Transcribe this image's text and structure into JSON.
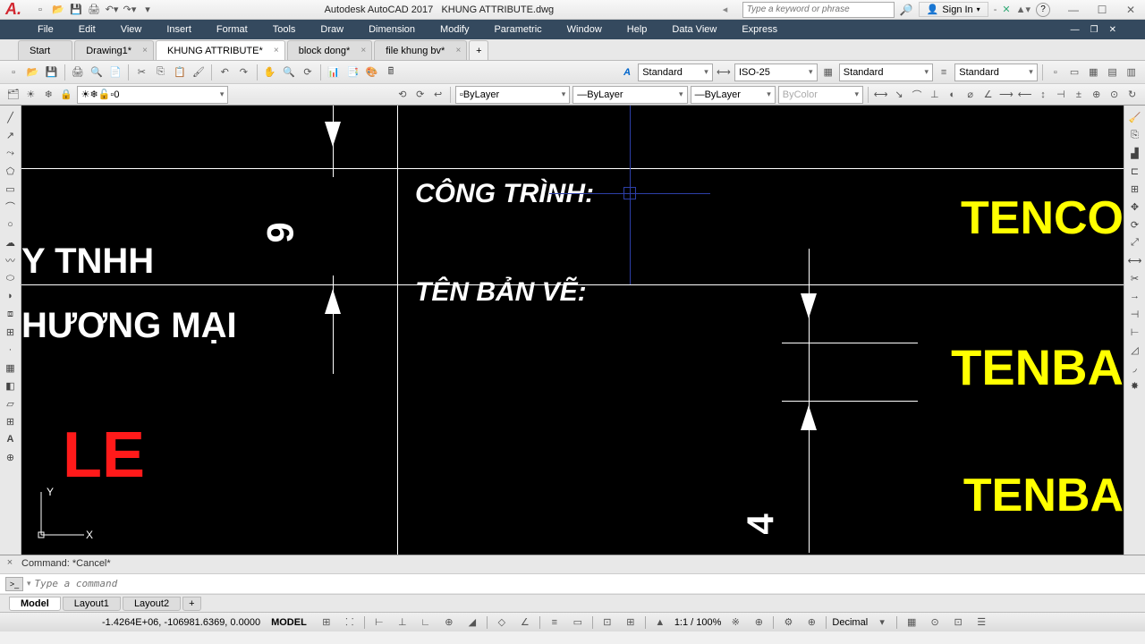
{
  "title": {
    "app": "Autodesk AutoCAD 2017",
    "doc": "KHUNG ATTRIBUTE.dwg"
  },
  "search": {
    "placeholder": "Type a keyword or phrase"
  },
  "signin": {
    "label": "Sign In"
  },
  "menu": [
    "File",
    "Edit",
    "View",
    "Insert",
    "Format",
    "Tools",
    "Draw",
    "Dimension",
    "Modify",
    "Parametric",
    "Window",
    "Help",
    "Data View",
    "Express"
  ],
  "tabs": {
    "items": [
      "Start",
      "Drawing1*",
      "KHUNG ATTRIBUTE*",
      "block dong*",
      "file khung bv*"
    ],
    "active": 2
  },
  "ribbon": {
    "style1": "Standard",
    "dim": "ISO-25",
    "style2": "Standard",
    "style3": "Standard",
    "layer": "0",
    "prop1": "ByLayer",
    "prop2": "ByLayer",
    "prop3": "ByLayer",
    "prop4": "ByColor"
  },
  "drawing": {
    "t1": "Y TNHH",
    "t2": "HƯƠNG MẠI",
    "t3": "LE",
    "t4": "CÔNG TRÌNH:",
    "t5": "TÊN BẢN VẼ:",
    "t6": "TENCO",
    "t7": "TENBA",
    "t8": "TENBA",
    "dim1": "9",
    "dim2": "4"
  },
  "cmd": {
    "hist": "Command: *Cancel*",
    "placeholder": "Type a command"
  },
  "layouts": {
    "items": [
      "Model",
      "Layout1",
      "Layout2"
    ],
    "active": 0
  },
  "status": {
    "coords": "-1.4264E+06, -106981.6369, 0.0000",
    "mode": "MODEL",
    "scale": "1:1 / 100%",
    "units": "Decimal"
  }
}
